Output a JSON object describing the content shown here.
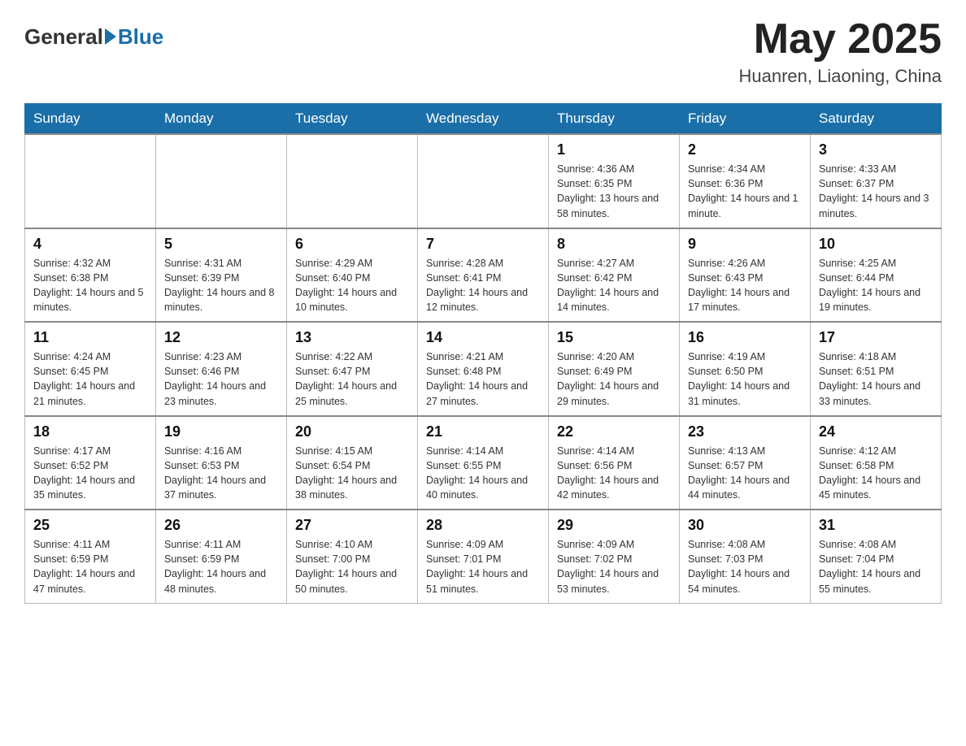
{
  "header": {
    "logo_general": "General",
    "logo_blue": "Blue",
    "month_title": "May 2025",
    "location": "Huanren, Liaoning, China"
  },
  "weekdays": [
    "Sunday",
    "Monday",
    "Tuesday",
    "Wednesday",
    "Thursday",
    "Friday",
    "Saturday"
  ],
  "weeks": [
    [
      {
        "day": "",
        "sunrise": "",
        "sunset": "",
        "daylight": ""
      },
      {
        "day": "",
        "sunrise": "",
        "sunset": "",
        "daylight": ""
      },
      {
        "day": "",
        "sunrise": "",
        "sunset": "",
        "daylight": ""
      },
      {
        "day": "",
        "sunrise": "",
        "sunset": "",
        "daylight": ""
      },
      {
        "day": "1",
        "sunrise": "Sunrise: 4:36 AM",
        "sunset": "Sunset: 6:35 PM",
        "daylight": "Daylight: 13 hours and 58 minutes."
      },
      {
        "day": "2",
        "sunrise": "Sunrise: 4:34 AM",
        "sunset": "Sunset: 6:36 PM",
        "daylight": "Daylight: 14 hours and 1 minute."
      },
      {
        "day": "3",
        "sunrise": "Sunrise: 4:33 AM",
        "sunset": "Sunset: 6:37 PM",
        "daylight": "Daylight: 14 hours and 3 minutes."
      }
    ],
    [
      {
        "day": "4",
        "sunrise": "Sunrise: 4:32 AM",
        "sunset": "Sunset: 6:38 PM",
        "daylight": "Daylight: 14 hours and 5 minutes."
      },
      {
        "day": "5",
        "sunrise": "Sunrise: 4:31 AM",
        "sunset": "Sunset: 6:39 PM",
        "daylight": "Daylight: 14 hours and 8 minutes."
      },
      {
        "day": "6",
        "sunrise": "Sunrise: 4:29 AM",
        "sunset": "Sunset: 6:40 PM",
        "daylight": "Daylight: 14 hours and 10 minutes."
      },
      {
        "day": "7",
        "sunrise": "Sunrise: 4:28 AM",
        "sunset": "Sunset: 6:41 PM",
        "daylight": "Daylight: 14 hours and 12 minutes."
      },
      {
        "day": "8",
        "sunrise": "Sunrise: 4:27 AM",
        "sunset": "Sunset: 6:42 PM",
        "daylight": "Daylight: 14 hours and 14 minutes."
      },
      {
        "day": "9",
        "sunrise": "Sunrise: 4:26 AM",
        "sunset": "Sunset: 6:43 PM",
        "daylight": "Daylight: 14 hours and 17 minutes."
      },
      {
        "day": "10",
        "sunrise": "Sunrise: 4:25 AM",
        "sunset": "Sunset: 6:44 PM",
        "daylight": "Daylight: 14 hours and 19 minutes."
      }
    ],
    [
      {
        "day": "11",
        "sunrise": "Sunrise: 4:24 AM",
        "sunset": "Sunset: 6:45 PM",
        "daylight": "Daylight: 14 hours and 21 minutes."
      },
      {
        "day": "12",
        "sunrise": "Sunrise: 4:23 AM",
        "sunset": "Sunset: 6:46 PM",
        "daylight": "Daylight: 14 hours and 23 minutes."
      },
      {
        "day": "13",
        "sunrise": "Sunrise: 4:22 AM",
        "sunset": "Sunset: 6:47 PM",
        "daylight": "Daylight: 14 hours and 25 minutes."
      },
      {
        "day": "14",
        "sunrise": "Sunrise: 4:21 AM",
        "sunset": "Sunset: 6:48 PM",
        "daylight": "Daylight: 14 hours and 27 minutes."
      },
      {
        "day": "15",
        "sunrise": "Sunrise: 4:20 AM",
        "sunset": "Sunset: 6:49 PM",
        "daylight": "Daylight: 14 hours and 29 minutes."
      },
      {
        "day": "16",
        "sunrise": "Sunrise: 4:19 AM",
        "sunset": "Sunset: 6:50 PM",
        "daylight": "Daylight: 14 hours and 31 minutes."
      },
      {
        "day": "17",
        "sunrise": "Sunrise: 4:18 AM",
        "sunset": "Sunset: 6:51 PM",
        "daylight": "Daylight: 14 hours and 33 minutes."
      }
    ],
    [
      {
        "day": "18",
        "sunrise": "Sunrise: 4:17 AM",
        "sunset": "Sunset: 6:52 PM",
        "daylight": "Daylight: 14 hours and 35 minutes."
      },
      {
        "day": "19",
        "sunrise": "Sunrise: 4:16 AM",
        "sunset": "Sunset: 6:53 PM",
        "daylight": "Daylight: 14 hours and 37 minutes."
      },
      {
        "day": "20",
        "sunrise": "Sunrise: 4:15 AM",
        "sunset": "Sunset: 6:54 PM",
        "daylight": "Daylight: 14 hours and 38 minutes."
      },
      {
        "day": "21",
        "sunrise": "Sunrise: 4:14 AM",
        "sunset": "Sunset: 6:55 PM",
        "daylight": "Daylight: 14 hours and 40 minutes."
      },
      {
        "day": "22",
        "sunrise": "Sunrise: 4:14 AM",
        "sunset": "Sunset: 6:56 PM",
        "daylight": "Daylight: 14 hours and 42 minutes."
      },
      {
        "day": "23",
        "sunrise": "Sunrise: 4:13 AM",
        "sunset": "Sunset: 6:57 PM",
        "daylight": "Daylight: 14 hours and 44 minutes."
      },
      {
        "day": "24",
        "sunrise": "Sunrise: 4:12 AM",
        "sunset": "Sunset: 6:58 PM",
        "daylight": "Daylight: 14 hours and 45 minutes."
      }
    ],
    [
      {
        "day": "25",
        "sunrise": "Sunrise: 4:11 AM",
        "sunset": "Sunset: 6:59 PM",
        "daylight": "Daylight: 14 hours and 47 minutes."
      },
      {
        "day": "26",
        "sunrise": "Sunrise: 4:11 AM",
        "sunset": "Sunset: 6:59 PM",
        "daylight": "Daylight: 14 hours and 48 minutes."
      },
      {
        "day": "27",
        "sunrise": "Sunrise: 4:10 AM",
        "sunset": "Sunset: 7:00 PM",
        "daylight": "Daylight: 14 hours and 50 minutes."
      },
      {
        "day": "28",
        "sunrise": "Sunrise: 4:09 AM",
        "sunset": "Sunset: 7:01 PM",
        "daylight": "Daylight: 14 hours and 51 minutes."
      },
      {
        "day": "29",
        "sunrise": "Sunrise: 4:09 AM",
        "sunset": "Sunset: 7:02 PM",
        "daylight": "Daylight: 14 hours and 53 minutes."
      },
      {
        "day": "30",
        "sunrise": "Sunrise: 4:08 AM",
        "sunset": "Sunset: 7:03 PM",
        "daylight": "Daylight: 14 hours and 54 minutes."
      },
      {
        "day": "31",
        "sunrise": "Sunrise: 4:08 AM",
        "sunset": "Sunset: 7:04 PM",
        "daylight": "Daylight: 14 hours and 55 minutes."
      }
    ]
  ]
}
